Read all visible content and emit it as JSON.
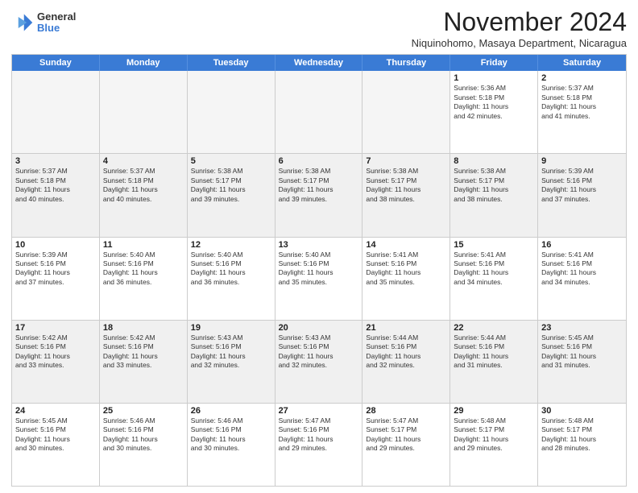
{
  "logo": {
    "general": "General",
    "blue": "Blue"
  },
  "title": "November 2024",
  "subtitle": "Niquinohomo, Masaya Department, Nicaragua",
  "days_of_week": [
    "Sunday",
    "Monday",
    "Tuesday",
    "Wednesday",
    "Thursday",
    "Friday",
    "Saturday"
  ],
  "weeks": [
    [
      {
        "day": "",
        "info": ""
      },
      {
        "day": "",
        "info": ""
      },
      {
        "day": "",
        "info": ""
      },
      {
        "day": "",
        "info": ""
      },
      {
        "day": "",
        "info": ""
      },
      {
        "day": "1",
        "info": "Sunrise: 5:36 AM\nSunset: 5:18 PM\nDaylight: 11 hours\nand 42 minutes."
      },
      {
        "day": "2",
        "info": "Sunrise: 5:37 AM\nSunset: 5:18 PM\nDaylight: 11 hours\nand 41 minutes."
      }
    ],
    [
      {
        "day": "3",
        "info": "Sunrise: 5:37 AM\nSunset: 5:18 PM\nDaylight: 11 hours\nand 40 minutes."
      },
      {
        "day": "4",
        "info": "Sunrise: 5:37 AM\nSunset: 5:18 PM\nDaylight: 11 hours\nand 40 minutes."
      },
      {
        "day": "5",
        "info": "Sunrise: 5:38 AM\nSunset: 5:17 PM\nDaylight: 11 hours\nand 39 minutes."
      },
      {
        "day": "6",
        "info": "Sunrise: 5:38 AM\nSunset: 5:17 PM\nDaylight: 11 hours\nand 39 minutes."
      },
      {
        "day": "7",
        "info": "Sunrise: 5:38 AM\nSunset: 5:17 PM\nDaylight: 11 hours\nand 38 minutes."
      },
      {
        "day": "8",
        "info": "Sunrise: 5:38 AM\nSunset: 5:17 PM\nDaylight: 11 hours\nand 38 minutes."
      },
      {
        "day": "9",
        "info": "Sunrise: 5:39 AM\nSunset: 5:16 PM\nDaylight: 11 hours\nand 37 minutes."
      }
    ],
    [
      {
        "day": "10",
        "info": "Sunrise: 5:39 AM\nSunset: 5:16 PM\nDaylight: 11 hours\nand 37 minutes."
      },
      {
        "day": "11",
        "info": "Sunrise: 5:40 AM\nSunset: 5:16 PM\nDaylight: 11 hours\nand 36 minutes."
      },
      {
        "day": "12",
        "info": "Sunrise: 5:40 AM\nSunset: 5:16 PM\nDaylight: 11 hours\nand 36 minutes."
      },
      {
        "day": "13",
        "info": "Sunrise: 5:40 AM\nSunset: 5:16 PM\nDaylight: 11 hours\nand 35 minutes."
      },
      {
        "day": "14",
        "info": "Sunrise: 5:41 AM\nSunset: 5:16 PM\nDaylight: 11 hours\nand 35 minutes."
      },
      {
        "day": "15",
        "info": "Sunrise: 5:41 AM\nSunset: 5:16 PM\nDaylight: 11 hours\nand 34 minutes."
      },
      {
        "day": "16",
        "info": "Sunrise: 5:41 AM\nSunset: 5:16 PM\nDaylight: 11 hours\nand 34 minutes."
      }
    ],
    [
      {
        "day": "17",
        "info": "Sunrise: 5:42 AM\nSunset: 5:16 PM\nDaylight: 11 hours\nand 33 minutes."
      },
      {
        "day": "18",
        "info": "Sunrise: 5:42 AM\nSunset: 5:16 PM\nDaylight: 11 hours\nand 33 minutes."
      },
      {
        "day": "19",
        "info": "Sunrise: 5:43 AM\nSunset: 5:16 PM\nDaylight: 11 hours\nand 32 minutes."
      },
      {
        "day": "20",
        "info": "Sunrise: 5:43 AM\nSunset: 5:16 PM\nDaylight: 11 hours\nand 32 minutes."
      },
      {
        "day": "21",
        "info": "Sunrise: 5:44 AM\nSunset: 5:16 PM\nDaylight: 11 hours\nand 32 minutes."
      },
      {
        "day": "22",
        "info": "Sunrise: 5:44 AM\nSunset: 5:16 PM\nDaylight: 11 hours\nand 31 minutes."
      },
      {
        "day": "23",
        "info": "Sunrise: 5:45 AM\nSunset: 5:16 PM\nDaylight: 11 hours\nand 31 minutes."
      }
    ],
    [
      {
        "day": "24",
        "info": "Sunrise: 5:45 AM\nSunset: 5:16 PM\nDaylight: 11 hours\nand 30 minutes."
      },
      {
        "day": "25",
        "info": "Sunrise: 5:46 AM\nSunset: 5:16 PM\nDaylight: 11 hours\nand 30 minutes."
      },
      {
        "day": "26",
        "info": "Sunrise: 5:46 AM\nSunset: 5:16 PM\nDaylight: 11 hours\nand 30 minutes."
      },
      {
        "day": "27",
        "info": "Sunrise: 5:47 AM\nSunset: 5:16 PM\nDaylight: 11 hours\nand 29 minutes."
      },
      {
        "day": "28",
        "info": "Sunrise: 5:47 AM\nSunset: 5:17 PM\nDaylight: 11 hours\nand 29 minutes."
      },
      {
        "day": "29",
        "info": "Sunrise: 5:48 AM\nSunset: 5:17 PM\nDaylight: 11 hours\nand 29 minutes."
      },
      {
        "day": "30",
        "info": "Sunrise: 5:48 AM\nSunset: 5:17 PM\nDaylight: 11 hours\nand 28 minutes."
      }
    ]
  ]
}
